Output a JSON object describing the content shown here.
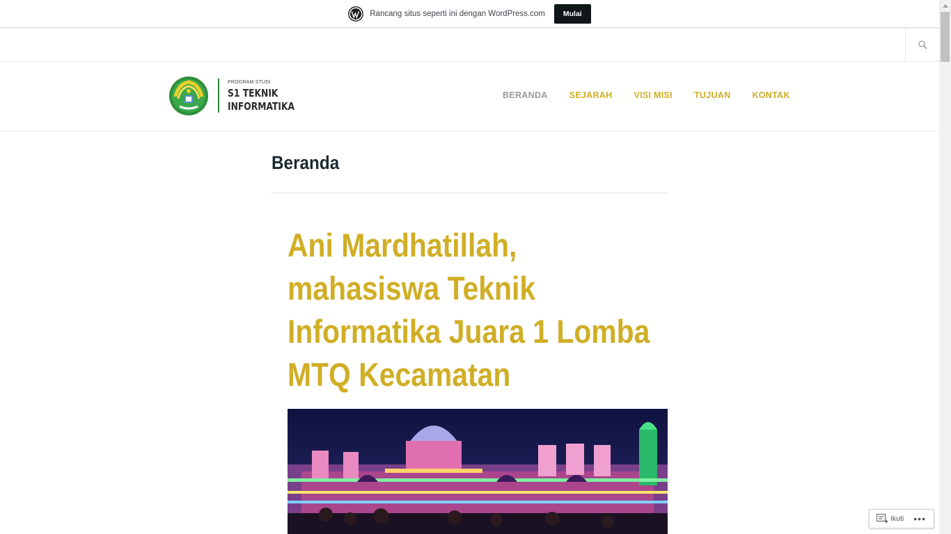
{
  "wp_banner": {
    "text": "Rancang situs seperti ini dengan WordPress.com",
    "button": "Mulai"
  },
  "header": {
    "logo_small": "PROGRAM STUDI",
    "logo_line1": "S1 TEKNIK",
    "logo_line2": "INFORMATIKA",
    "nav": [
      "BERANDA",
      "SEJARAH",
      "VISI MISI",
      "TUJUAN",
      "KONTAK"
    ]
  },
  "content": {
    "page_title": "Beranda",
    "post_title": "Ani Mardhatillah, mahasiswa Teknik Informatika Juara 1 Lomba MTQ Kecamatan"
  },
  "follow": {
    "label": "Ikuti",
    "more": "•••"
  },
  "icons": {
    "wordpress": "wordpress-logo-icon",
    "search": "search-icon",
    "follow": "follow-icon"
  },
  "colors": {
    "accent": "#d0ae25",
    "nav_current": "#9a9a9a",
    "heading": "#1d2932",
    "logo_green": "#2a8a3e"
  }
}
